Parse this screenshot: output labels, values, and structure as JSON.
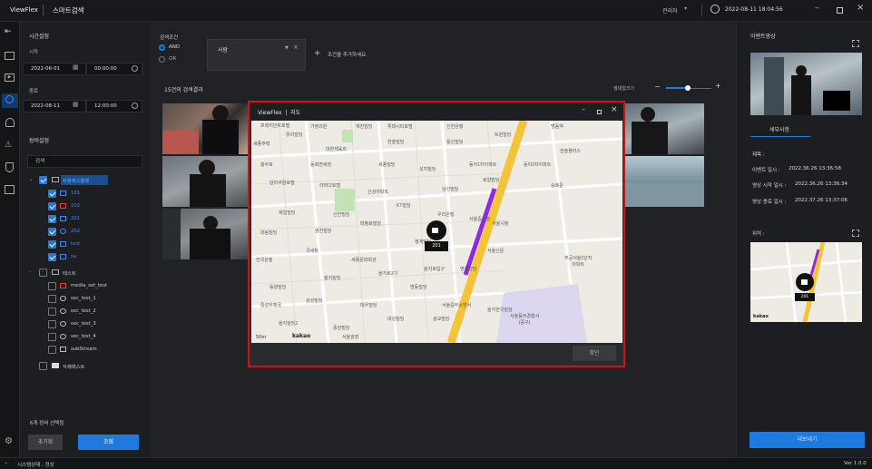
{
  "app": {
    "name": "ViewFlex",
    "page": "스마트검색",
    "user": "관리자",
    "datetime": "2022-08-11 18:04:56"
  },
  "time_settings": {
    "header": "시간설정",
    "start_label": "시작",
    "start_date": "2022-06-01",
    "start_time": "00:00:00",
    "end_label": "종료",
    "end_date": "2022-08-11",
    "end_time": "12:00:00"
  },
  "device_settings": {
    "header": "장비설정",
    "search_placeholder": "검색",
    "groups": [
      {
        "label": "뷰플렉스플랫",
        "checked": true,
        "items": [
          "101",
          "102",
          "201",
          "202",
          "test",
          "sa"
        ]
      },
      {
        "label": "테스트",
        "checked": false,
        "items": [
          "media_set_test",
          "sec_test_1",
          "sec_test_2",
          "sec_test_3",
          "sec_test_4",
          "subStream"
        ]
      },
      {
        "label": "삭제테스트",
        "checked": false,
        "items": []
      }
    ],
    "selected_count": "6개 장비 선택됨",
    "reset_label": "초기화",
    "search_label": "조회"
  },
  "conditions": {
    "header": "검색조건",
    "and_label": "AND",
    "or_label": "OR",
    "condition_value": "사람",
    "add_label": "조건을 추가하세요.",
    "match": "AND"
  },
  "results": {
    "count_label": "15건의 검색결과",
    "size_label": "썸네일크기"
  },
  "map_window": {
    "title": "ViewFlex  |  지도",
    "marker_label": "201",
    "confirm_label": "확인",
    "scale_label": "50m",
    "logo": "kakao",
    "labels": [
      "프레지던트호텔",
      "가정의원",
      "예진빌딩",
      "롯데시티호텔",
      "신한은행",
      "트윈빌딩",
      "명동역",
      "세종주택",
      "뮤리빌딩",
      "대한체육회",
      "한솔빌딩",
      "동인빌딩",
      "한솔플러스",
      "충무로",
      "동화면세점",
      "세종빌딩",
      "성지빌딩",
      "동아1차아파트",
      "동아2차아파트",
      "달리쿠알호텔",
      "라마다호텔",
      "신성아파트",
      "남산빌딩",
      "로얄빌딩",
      "숭례문",
      "제일빌딩",
      "신한빌딩",
      "KT빌딩",
      "우리은행",
      "서울중구청",
      "대림빌딩",
      "영진빌딩",
      "태평로빌딩",
      "서울시청",
      "한국은행",
      "국세청",
      "세종문화회관",
      "청계빌딩",
      "서울신문",
      "동양빌딩",
      "을지빌딩",
      "을지로3가",
      "을지로입구",
      "명동성당",
      "중앙우체국",
      "삼성빌딩",
      "대우빌딩",
      "명동빌딩",
      "서울중부소방서",
      "을지빌딩2",
      "중앙빌딩",
      "대성빌딩",
      "광교빌딩",
      "을지한국빌딩",
      "서울광장"
    ],
    "poi_labels": [
      "주공서울1단지\n아파트",
      "서울동부경찰서\n(중구)"
    ]
  },
  "right_panel": {
    "event_video_label": "이벤트영상",
    "details_tab": "세부사항",
    "title_label": "제목 :",
    "event_time_label": "이벤트 일시 :",
    "event_time": "2022.36.26 13:36:58",
    "video_start_label": "영상 시작 일시 :",
    "video_start": "2022.36.26 13:36:34",
    "video_end_label": "영상 종료 일시 :",
    "video_end": "2022.37.26 13:37:06",
    "location_label": "위치 :",
    "mini_marker": "201",
    "mini_logo": "kakao",
    "export_label": "내보내기"
  },
  "status_bar": {
    "text": "시스템상태 : 정상",
    "version": "Ver 1.0.0"
  },
  "colors": {
    "accent": "#1f7ae0",
    "highlight": "#d41010",
    "route": "#8b2be2",
    "road": "#f3c33a"
  }
}
